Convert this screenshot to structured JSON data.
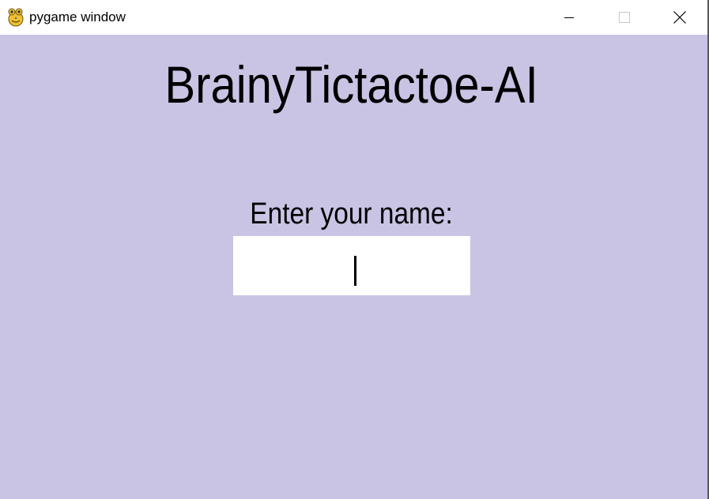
{
  "window": {
    "title": "pygame window",
    "app_icon": "pygame-snake-icon",
    "controls": {
      "minimize_icon": "minimize-icon",
      "maximize_icon": "maximize-icon",
      "maximize_enabled": false,
      "close_icon": "close-icon"
    }
  },
  "screen": {
    "heading": "BrainyTictactoe-AI",
    "name_prompt": "Enter your name:",
    "name_input": {
      "value": "",
      "focused": true
    }
  },
  "colors": {
    "background": "#c9c3e4",
    "input_background": "#ffffff",
    "text": "#000000"
  }
}
